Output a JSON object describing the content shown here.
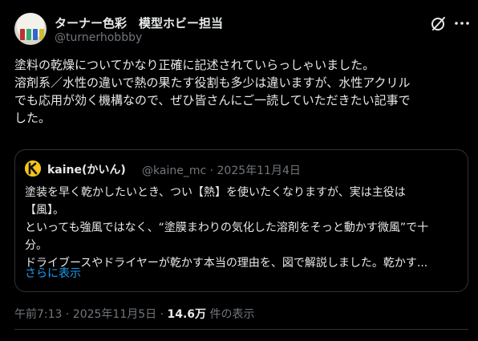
{
  "author": {
    "display_name": "ターナー色彩　模型ホビー担当",
    "handle": "@turnerhobbby",
    "avatar_icon": "hobby-paint-avatar"
  },
  "header_actions": {
    "grok_icon": "grok-icon",
    "more_icon": "more-icon"
  },
  "post": {
    "lines": [
      "塗料の乾燥についてかなり正確に記述されていらっしゃいました。",
      "溶剤系／水性の違いで熱の果たす役割も多少は違いますが、水性アクリル",
      "でも応用が効く機構なので、ぜひ皆さんにご一読していただきたい記事で",
      "した。"
    ]
  },
  "quote": {
    "name": "kaine(かいん)",
    "handle_date": "@kaine_mc · 2025年11月4日",
    "avatar_icon": "kaine-k-avatar",
    "lines": [
      "塗装を早く乾かしたいとき、つい【熱】を使いたくなりますが、実は主役は",
      "【風】。",
      "といっても強風ではなく、“塗膜まわりの気化した溶剤をそっと動かす微風”で十",
      "分。",
      "ドライブースやドライヤーが乾かす本当の理由を、図で解説しました。乾かす..."
    ],
    "show_more": "さらに表示"
  },
  "meta": {
    "time_date": "午前7:13 · 2025年11月5日 · ",
    "views": "14.6万",
    "views_suffix": " 件の表示"
  },
  "colors": {
    "background": "#000000",
    "text": "#e7e9ea",
    "secondary": "#71767b",
    "link": "#1d9bf0",
    "border": "#2f3336"
  }
}
